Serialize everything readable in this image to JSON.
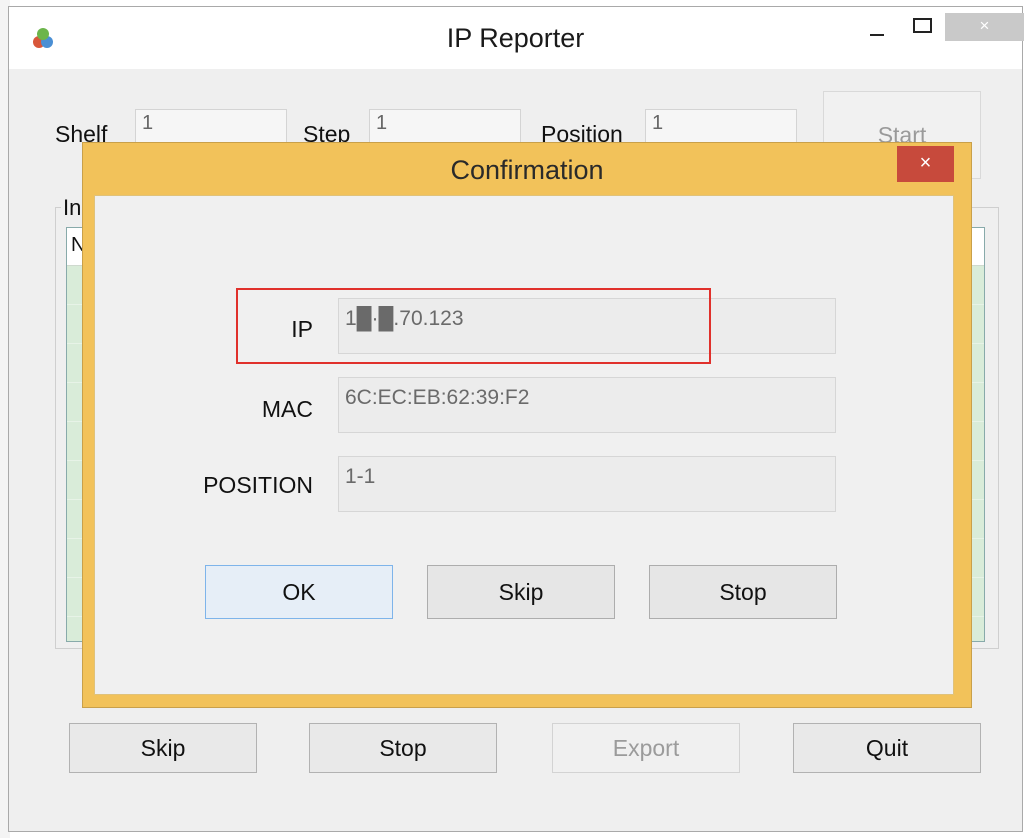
{
  "window": {
    "title": "IP Reporter",
    "close_glyph": "×"
  },
  "form": {
    "shelf_label": "Shelf",
    "shelf_value": "1",
    "step_label": "Step",
    "step_value": "1",
    "position_label": "Position",
    "position_value": "1",
    "start_label": "Start"
  },
  "group": {
    "label": "In",
    "header_fragment": "N"
  },
  "footer": {
    "skip_label": "Skip",
    "stop_label": "Stop",
    "export_label": "Export",
    "quit_label": "Quit"
  },
  "dialog": {
    "title": "Confirmation",
    "close_glyph": "×",
    "ip_label": "IP",
    "ip_value": "1█·█.70.123",
    "mac_label": "MAC",
    "mac_value": "6C:EC:EB:62:39:F2",
    "position_label": "POSITION",
    "position_value": "1-1",
    "ok_label": "OK",
    "skip_label": "Skip",
    "stop_label": "Stop"
  },
  "colors": {
    "dialog_frame": "#f2c25a",
    "dialog_close": "#c74a3c",
    "highlight": "#e0302b",
    "list_rows": "#d9ecd9"
  }
}
